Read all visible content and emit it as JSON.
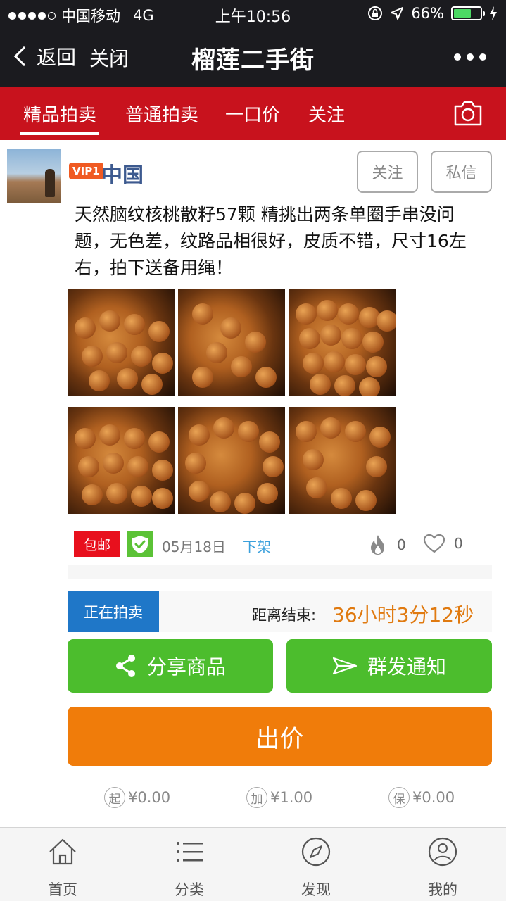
{
  "status_bar": {
    "carrier": "中国移动",
    "network": "4G",
    "time": "上午10:56",
    "battery": "66%",
    "battery_level": 0.66
  },
  "nav": {
    "back_label": "返回",
    "close_label": "关闭",
    "title": "榴莲二手街"
  },
  "tabs": [
    {
      "label": "精品拍卖",
      "active": true
    },
    {
      "label": "普通拍卖",
      "active": false
    },
    {
      "label": "一口价",
      "active": false
    },
    {
      "label": "关注",
      "active": false
    }
  ],
  "post": {
    "vip_badge": "VIP1",
    "username": "中国",
    "follow_label": "关注",
    "message_label": "私信",
    "description": "天然脑纹核桃散籽57颗 精挑出两条单圈手串没问题，无色差，纹路品相很好，皮质不错，尺寸16左右，拍下送备用绳！",
    "free_shipping": "包邮",
    "date": "05月18日",
    "offline_label": "下架",
    "hot_count": "0",
    "like_count": "0",
    "auction_status": "正在拍卖",
    "countdown_label": "距离结束:",
    "countdown": "36小时3分12秒",
    "share_label": "分享商品",
    "notify_label": "群发通知",
    "bid_label": "出价",
    "start_price_icon": "起",
    "start_price": "¥0.00",
    "increment_icon": "加",
    "increment": "¥1.00",
    "deposit_icon": "保",
    "deposit": "¥0.00"
  },
  "bottom_tabs": [
    {
      "label": "首页",
      "icon": "home-icon"
    },
    {
      "label": "分类",
      "icon": "list-icon"
    },
    {
      "label": "发现",
      "icon": "compass-icon"
    },
    {
      "label": "我的",
      "icon": "user-icon"
    }
  ],
  "colors": {
    "nav_bg": "#1b1b1f",
    "tab_bg": "#c8121d",
    "green": "#4cbd2d",
    "orange": "#f07c0a",
    "blue": "#1f77c8"
  }
}
